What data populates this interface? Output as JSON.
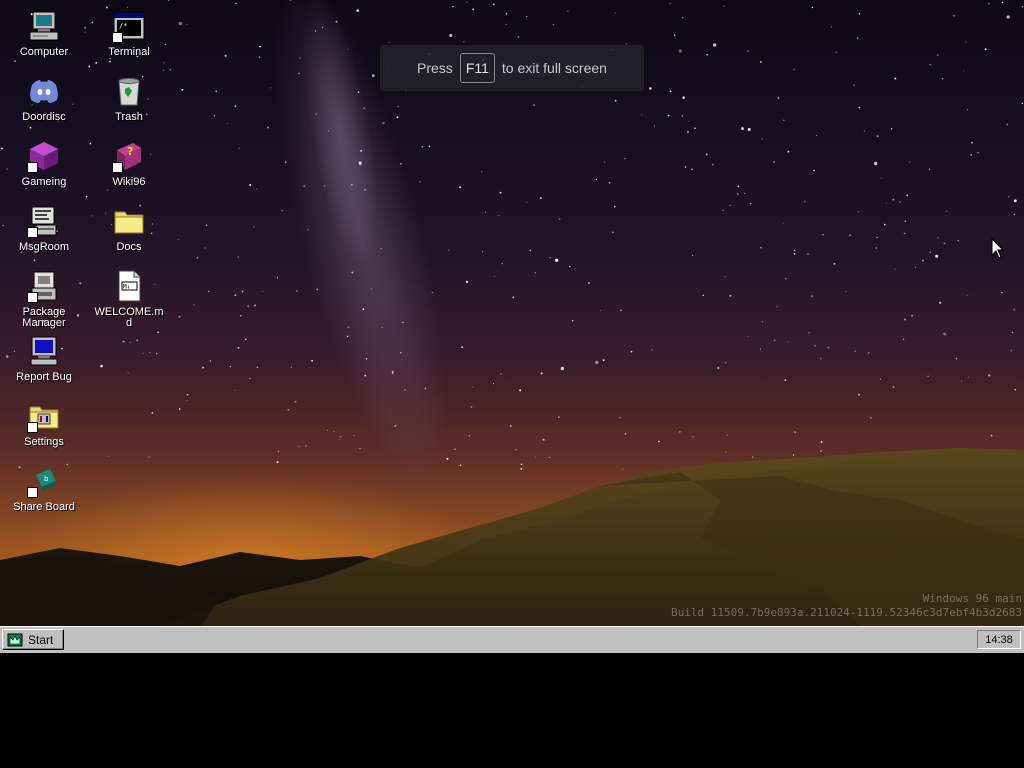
{
  "fullscreen_toast": {
    "prefix": "Press",
    "key": "F11",
    "suffix": "to exit full screen"
  },
  "desktop": {
    "icons": [
      {
        "id": "computer",
        "label": "Computer",
        "icon": "computer-icon"
      },
      {
        "id": "terminal",
        "label": "Terminal",
        "icon": "terminal-icon"
      },
      {
        "id": "doordisc",
        "label": "Doordisc",
        "icon": "discord-icon"
      },
      {
        "id": "trash",
        "label": "Trash",
        "icon": "trash-icon"
      },
      {
        "id": "gameing",
        "label": "Gameing",
        "icon": "game-cube-icon"
      },
      {
        "id": "wiki96",
        "label": "Wiki96",
        "icon": "help-book-icon"
      },
      {
        "id": "msgroom",
        "label": "MsgRoom",
        "icon": "chat-computer-icon"
      },
      {
        "id": "docs",
        "label": "Docs",
        "icon": "folder-icon"
      },
      {
        "id": "package-manager",
        "label": "Package Manager",
        "icon": "package-icon"
      },
      {
        "id": "welcome",
        "label": "WELCOME.md",
        "icon": "markdown-file-icon"
      },
      {
        "id": "report-bug",
        "label": "Report Bug",
        "icon": "monitor-bug-icon"
      },
      {
        "id": "settings",
        "label": "Settings",
        "icon": "settings-folder-icon"
      },
      {
        "id": "share-board",
        "label": "Share Board",
        "icon": "share-board-icon"
      }
    ]
  },
  "watermark": {
    "line1": "Windows 96 main",
    "line2": "Build 11509.7b9e893a.211024-1119.52346c3d7ebf4b3d2683"
  },
  "taskbar": {
    "start_label": "Start",
    "clock": "14:38"
  },
  "colors": {
    "taskbar": "#c0c0c0",
    "toast_bg": "#26262a",
    "folder": "#f0e68c"
  }
}
